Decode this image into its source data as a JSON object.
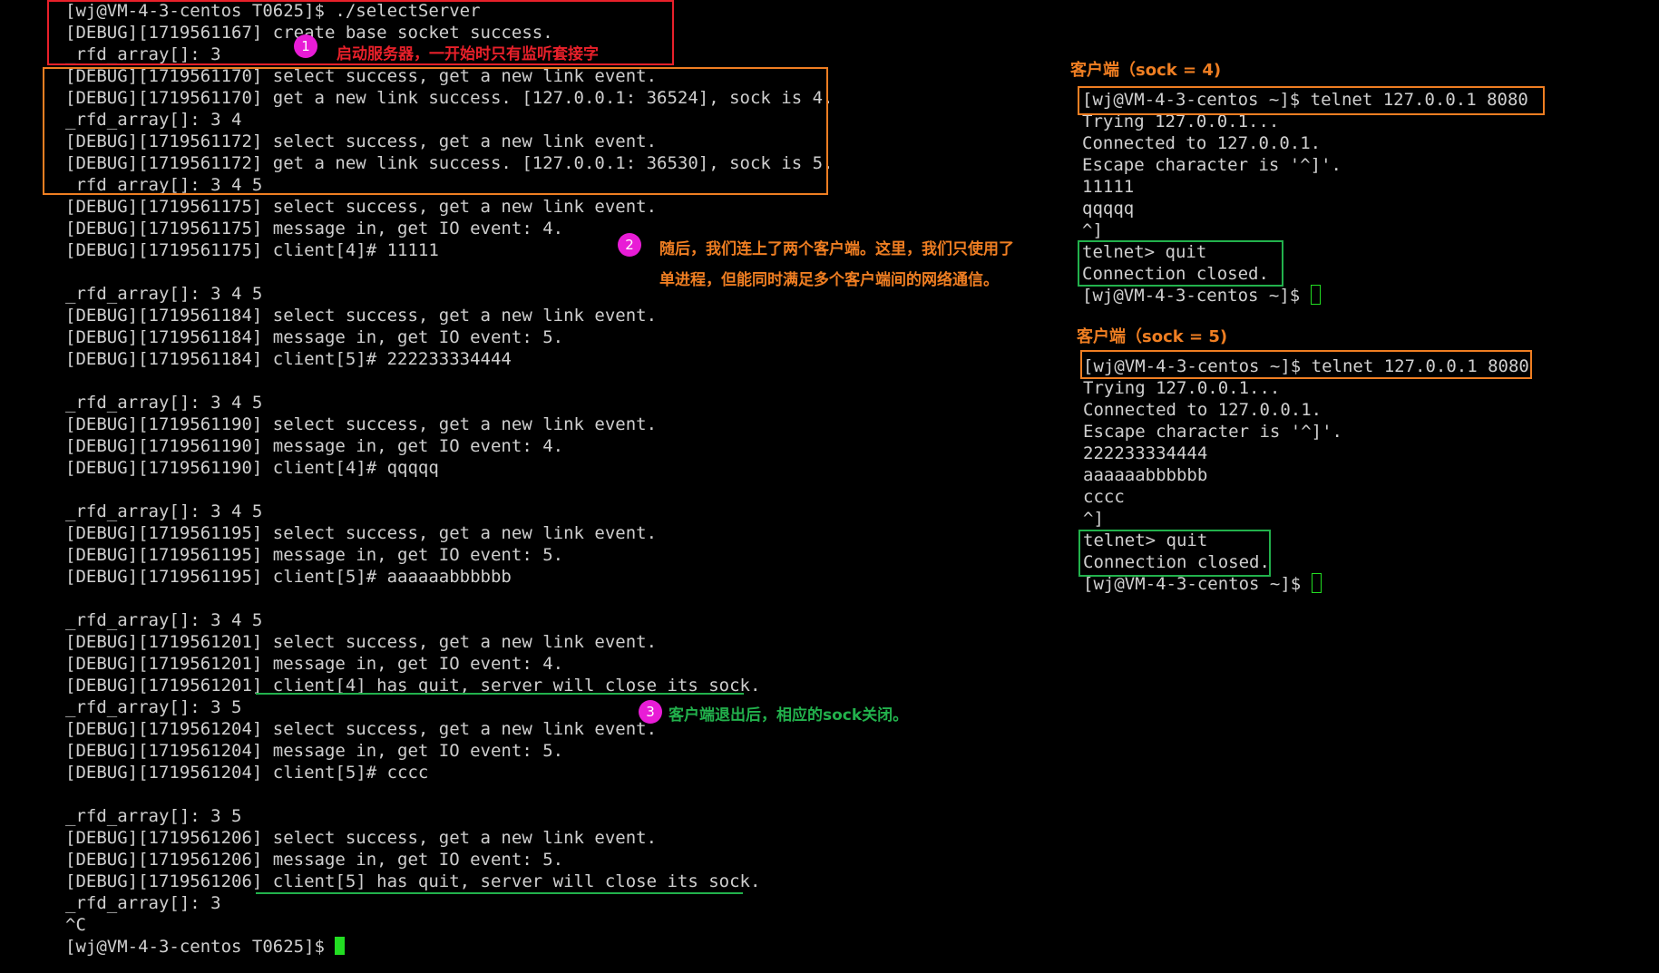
{
  "server_terminal": {
    "lines": [
      "[wj@VM-4-3-centos T0625]$ ./selectServer",
      "[DEBUG][1719561167] create base socket success.",
      "_rfd_array[]: 3",
      "[DEBUG][1719561170] select success, get a new link event.",
      "[DEBUG][1719561170] get a new link success. [127.0.0.1: 36524], sock is 4.",
      "_rfd_array[]: 3 4",
      "[DEBUG][1719561172] select success, get a new link event.",
      "[DEBUG][1719561172] get a new link success. [127.0.0.1: 36530], sock is 5.",
      "_rfd_array[]: 3 4 5",
      "[DEBUG][1719561175] select success, get a new link event.",
      "[DEBUG][1719561175] message in, get IO event: 4.",
      "[DEBUG][1719561175] client[4]# 11111",
      "",
      "_rfd_array[]: 3 4 5",
      "[DEBUG][1719561184] select success, get a new link event.",
      "[DEBUG][1719561184] message in, get IO event: 5.",
      "[DEBUG][1719561184] client[5]# 222233334444",
      "",
      "_rfd_array[]: 3 4 5",
      "[DEBUG][1719561190] select success, get a new link event.",
      "[DEBUG][1719561190] message in, get IO event: 4.",
      "[DEBUG][1719561190] client[4]# qqqqq",
      "",
      "_rfd_array[]: 3 4 5",
      "[DEBUG][1719561195] select success, get a new link event.",
      "[DEBUG][1719561195] message in, get IO event: 5.",
      "[DEBUG][1719561195] client[5]# aaaaaabbbbbb",
      "",
      "_rfd_array[]: 3 4 5",
      "[DEBUG][1719561201] select success, get a new link event.",
      "[DEBUG][1719561201] message in, get IO event: 4.",
      "[DEBUG][1719561201] client[4] has quit, server will close its sock.",
      "_rfd_array[]: 3 5",
      "[DEBUG][1719561204] select success, get a new link event.",
      "[DEBUG][1719561204] message in, get IO event: 5.",
      "[DEBUG][1719561204] client[5]# cccc",
      "",
      "_rfd_array[]: 3 5",
      "[DEBUG][1719561206] select success, get a new link event.",
      "[DEBUG][1719561206] message in, get IO event: 5.",
      "[DEBUG][1719561206] client[5] has quit, server will close its sock.",
      "_rfd_array[]: 3",
      "^C"
    ],
    "prompt": "[wj@VM-4-3-centos T0625]$ "
  },
  "client4": {
    "title": "客户端（sock = 4)",
    "lines": [
      "[wj@VM-4-3-centos ~]$ telnet 127.0.0.1 8080",
      "Trying 127.0.0.1...",
      "Connected to 127.0.0.1.",
      "Escape character is '^]'.",
      "11111",
      "qqqqq",
      "^]",
      "telnet> quit",
      "Connection closed."
    ],
    "prompt": "[wj@VM-4-3-centos ~]$ "
  },
  "client5": {
    "title": "客户端（sock = 5)",
    "lines": [
      "[wj@VM-4-3-centos ~]$ telnet 127.0.0.1 8080",
      "Trying 127.0.0.1...",
      "Connected to 127.0.0.1.",
      "Escape character is '^]'.",
      "222233334444",
      "aaaaaabbbbbb",
      "cccc",
      "^]",
      "telnet> quit",
      "Connection closed."
    ],
    "prompt": "[wj@VM-4-3-centos ~]$ "
  },
  "annotations": {
    "step1": {
      "number": "1",
      "text": "启动服务器，一开始时只有监听套接字"
    },
    "step2": {
      "number": "2",
      "line1": "随后，我们连上了两个客户端。这里，我们只使用了",
      "line2": "单进程，但能同时满足多个客户端间的网络通信。"
    },
    "step3": {
      "number": "3",
      "text": "客户端退出后，相应的sock关闭。"
    }
  },
  "colors": {
    "terminal_background": "#000000",
    "terminal_text": "#cfcfcf",
    "cursor": "#22dd22",
    "badge": "#e81cd6",
    "red": "#e8202a",
    "orange": "#ef7e22",
    "green": "#22b14c"
  }
}
